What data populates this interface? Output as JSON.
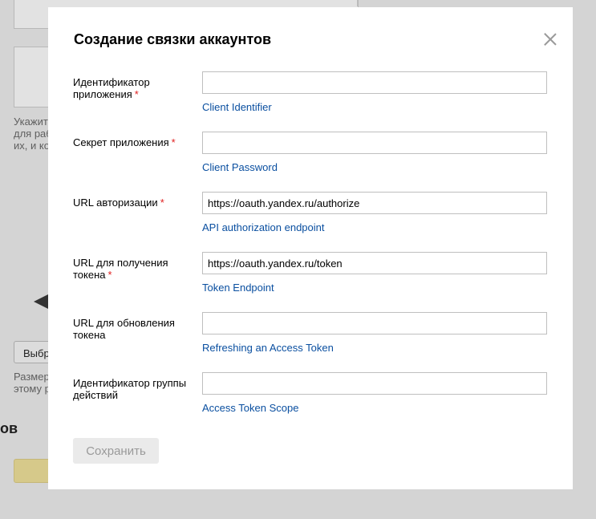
{
  "background": {
    "hint_text_lines": [
      "Укажит",
      "для раб",
      "их, и ко"
    ],
    "select_button": "Выбр",
    "size_text_lines": [
      "Размер",
      "этому р"
    ],
    "section_heading": "ов"
  },
  "modal": {
    "title": "Создание связки аккаунтов",
    "save_label": "Сохранить",
    "fields": [
      {
        "label": "Идентификатор приложения",
        "required": "*",
        "value": "",
        "hint": "Client Identifier"
      },
      {
        "label": "Секрет приложения",
        "required": "*",
        "value": "",
        "hint": "Client Password"
      },
      {
        "label": "URL авторизации",
        "required": "*",
        "value": "https://oauth.yandex.ru/authorize",
        "hint": "API authorization endpoint"
      },
      {
        "label": "URL для получения токена",
        "required": "*",
        "value": "https://oauth.yandex.ru/token",
        "hint": "Token Endpoint"
      },
      {
        "label": "URL для обновления токена",
        "required": "",
        "value": "",
        "hint": "Refreshing an Access Token"
      },
      {
        "label": "Идентификатор группы действий",
        "required": "",
        "value": "",
        "hint": "Access Token Scope"
      }
    ]
  },
  "colors": {
    "link": "#0a4fa0",
    "required": "#e02020",
    "overlay": "#d4d4d4"
  }
}
